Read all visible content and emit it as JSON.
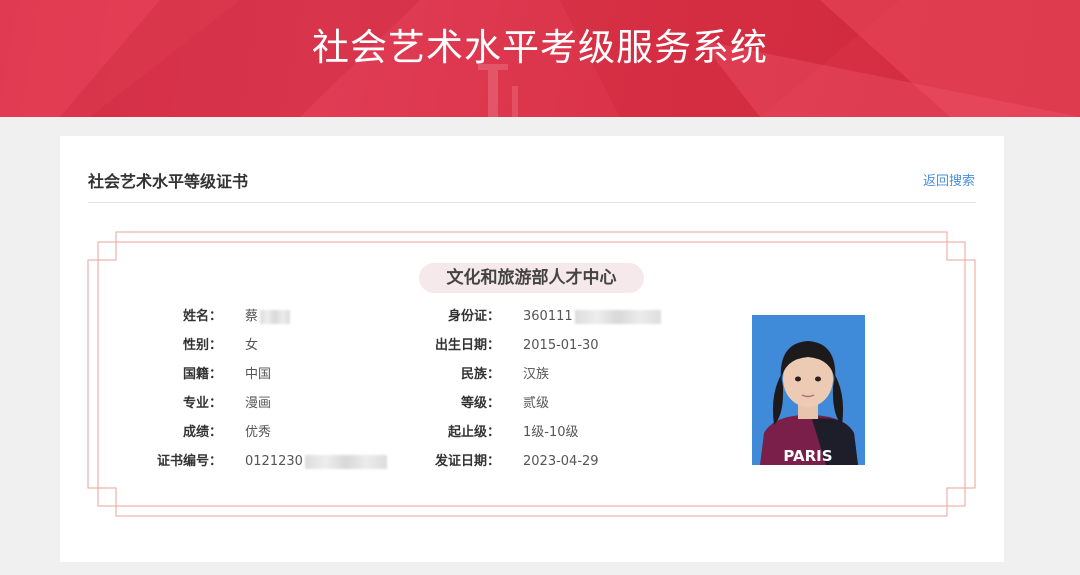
{
  "header": {
    "title": "社会艺术水平考级服务系统"
  },
  "card": {
    "title": "社会艺术水平等级证书",
    "back_link": "返回搜索"
  },
  "certificate": {
    "organization": "文化和旅游部人才中心",
    "left_fields": [
      {
        "label": "姓名：",
        "value": "蔡"
      },
      {
        "label": "性别：",
        "value": "女"
      },
      {
        "label": "国籍：",
        "value": "中国"
      },
      {
        "label": "专业：",
        "value": "漫画"
      },
      {
        "label": "成绩：",
        "value": "优秀"
      },
      {
        "label": "证书编号：",
        "value": "0121230"
      }
    ],
    "right_fields": [
      {
        "label": "身份证：",
        "value": "360111"
      },
      {
        "label": "出生日期：",
        "value": "2015-01-30"
      },
      {
        "label": "民族：",
        "value": "汉族"
      },
      {
        "label": "等级：",
        "value": "贰级"
      },
      {
        "label": "起止级：",
        "value": "1级-10级"
      },
      {
        "label": "发证日期：",
        "value": "2023-04-29"
      }
    ],
    "photo": {
      "shirt_text": "PARIS",
      "background_color": "#3f8bd9"
    }
  },
  "colors": {
    "banner": "#d9334a",
    "frame": "#e8a39a",
    "link": "#4a8fe0"
  }
}
